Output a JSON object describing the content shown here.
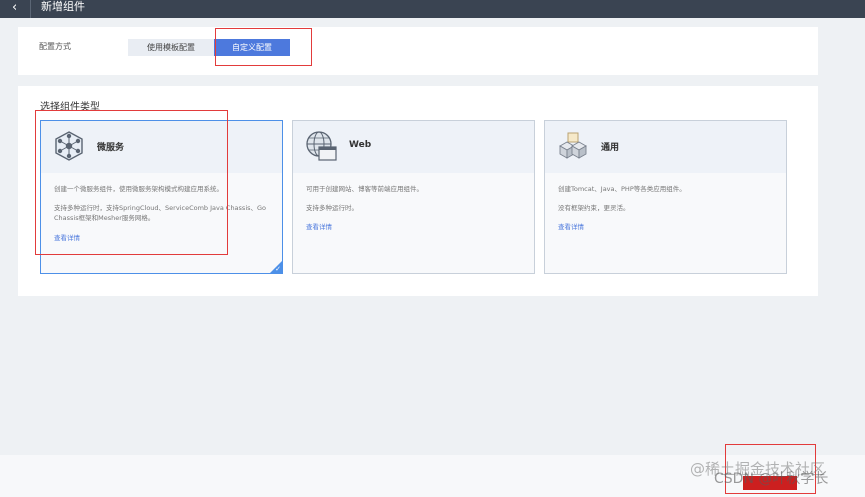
{
  "header": {
    "back_icon": "chevron-left-icon",
    "title": "新增组件"
  },
  "config": {
    "label": "配置方式",
    "options": [
      {
        "label": "使用模板配置",
        "selected": false
      },
      {
        "label": "自定义配置",
        "selected": true
      }
    ]
  },
  "component_types": {
    "title": "选择组件类型",
    "cards": [
      {
        "name": "微服务",
        "icon": "microservice-network-icon",
        "selected": true,
        "desc1": "创建一个微服务组件，使用微服务架构模式构建应用系统。",
        "desc2": "支持多种运行时，支持SpringCloud、ServiceComb Java Chassis、Go Chassis框架和Mesher服务网格。",
        "link": "查看详情"
      },
      {
        "name": "Web",
        "icon": "web-globe-icon",
        "selected": false,
        "desc1": "可用于创建网站、博客等前端应用组件。",
        "desc2": "支持多种运行时。",
        "link": "查看详情"
      },
      {
        "name": "通用",
        "icon": "general-cubes-icon",
        "selected": false,
        "desc1": "创建Tomcat、Java、PHP等各类应用组件。",
        "desc2": "没有框架约束，更灵活。",
        "link": "查看详情"
      }
    ]
  },
  "watermark": {
    "line1": "@稀土掘金技术社区",
    "line2": "CSDN @叶秋学长"
  },
  "colors": {
    "topbar": "#3a4452",
    "accent": "#4d79dd",
    "annotation": "#e23b3b",
    "confirm": "#cc1f1f"
  }
}
